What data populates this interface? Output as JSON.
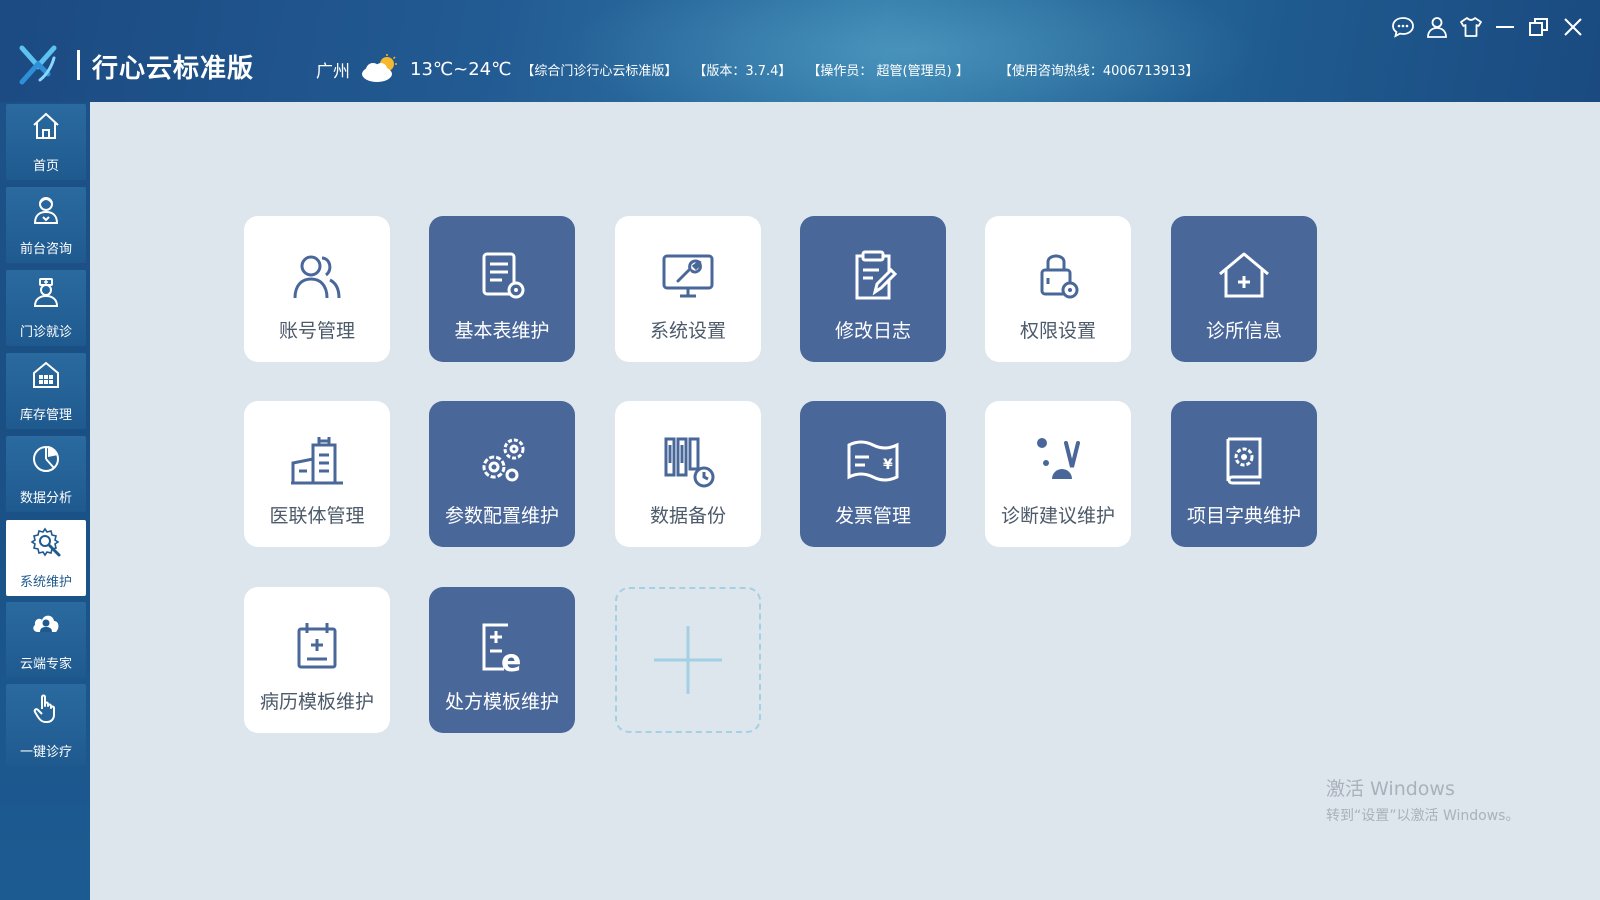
{
  "header": {
    "app_title": "行心云标准版",
    "city": "广州",
    "weather_icon": "partly-cloudy-icon",
    "temperature": "13℃~24℃",
    "edition_info": "【综合门诊行心云标准版】",
    "version_info": "【版本：3.7.4】",
    "operator_info": "【操作员：  超管(管理员) 】",
    "hotline_info": "【使用咨询热线：4006713913】",
    "window_controls": [
      "chat-icon",
      "user-icon",
      "skin-icon",
      "minimize-icon",
      "restore-icon",
      "close-icon"
    ]
  },
  "sidebar": {
    "items": [
      {
        "label": "首页",
        "icon": "home-icon",
        "active": false
      },
      {
        "label": "前台咨询",
        "icon": "consultant-icon",
        "active": false
      },
      {
        "label": "门诊就诊",
        "icon": "doctor-icon",
        "active": false
      },
      {
        "label": "库存管理",
        "icon": "warehouse-icon",
        "active": false
      },
      {
        "label": "数据分析",
        "icon": "pie-chart-icon",
        "active": false
      },
      {
        "label": "系统维护",
        "icon": "settings-wrench-icon",
        "active": true
      },
      {
        "label": "云端专家",
        "icon": "cloud-expert-icon",
        "active": false
      },
      {
        "label": "一键诊疗",
        "icon": "pointer-hand-icon",
        "active": false
      }
    ]
  },
  "tiles": [
    {
      "label": "账号管理",
      "icon": "users-icon",
      "style": "light"
    },
    {
      "label": "基本表维护",
      "icon": "table-settings-icon",
      "style": "dark"
    },
    {
      "label": "系统设置",
      "icon": "monitor-wrench-icon",
      "style": "light"
    },
    {
      "label": "修改日志",
      "icon": "clipboard-edit-icon",
      "style": "dark"
    },
    {
      "label": "权限设置",
      "icon": "lock-settings-icon",
      "style": "light"
    },
    {
      "label": "诊所信息",
      "icon": "clinic-house-icon",
      "style": "dark"
    },
    {
      "label": "医联体管理",
      "icon": "buildings-icon",
      "style": "light"
    },
    {
      "label": "参数配置维护",
      "icon": "gears-icon",
      "style": "dark"
    },
    {
      "label": "数据备份",
      "icon": "backup-binders-icon",
      "style": "light"
    },
    {
      "label": "发票管理",
      "icon": "invoice-icon",
      "style": "dark"
    },
    {
      "label": "诊断建议维护",
      "icon": "diagnosis-icon",
      "style": "light"
    },
    {
      "label": "项目字典维护",
      "icon": "dictionary-book-icon",
      "style": "dark"
    },
    {
      "label": "病历模板维护",
      "icon": "medical-record-icon",
      "style": "light"
    },
    {
      "label": "处方模板维护",
      "icon": "prescription-icon",
      "style": "dark"
    }
  ],
  "add_tile": {
    "icon": "plus-icon"
  },
  "watermark": {
    "line1": "激活 Windows",
    "line2": "转到“设置”以激活 Windows。"
  },
  "colors": {
    "header_blue": "#1f5a8e",
    "tile_dark": "#4a679a",
    "tile_light": "#ffffff",
    "background": "#dde5ed",
    "tile_text": "#4d5a6a",
    "add_dashed": "#a4d0e4"
  }
}
